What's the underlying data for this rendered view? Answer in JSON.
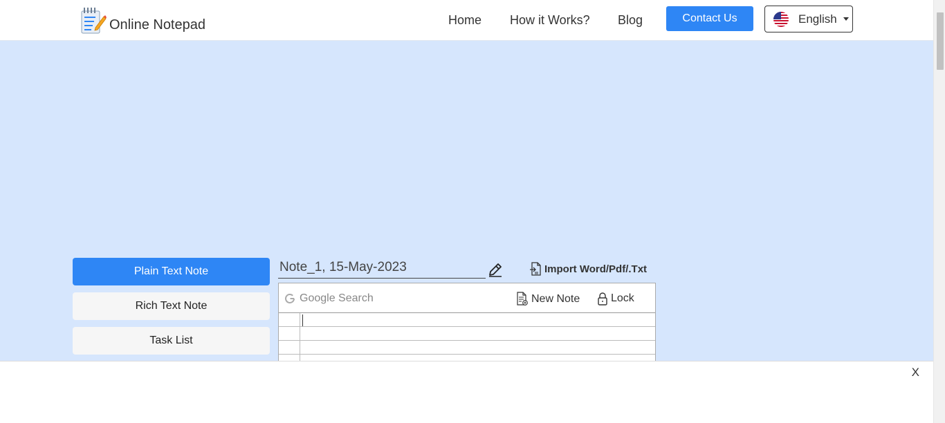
{
  "header": {
    "logo_text": "Online Notepad",
    "nav": [
      "Home",
      "How it Works?",
      "Blog"
    ],
    "contact_label": "Contact Us",
    "language": "English"
  },
  "sidebar": {
    "items": [
      {
        "label": "Plain Text Note",
        "active": true
      },
      {
        "label": "Rich Text Note",
        "active": false
      },
      {
        "label": "Task List",
        "active": false
      }
    ]
  },
  "note": {
    "title": "Note_1, 15-May-2023",
    "import_label": "Import Word/Pdf/.Txt"
  },
  "toolbar": {
    "search_placeholder": "Google Search",
    "new_note_label": "New Note",
    "lock_label": "Lock"
  },
  "bottom_bar": {
    "close_label": "X"
  },
  "colors": {
    "accent": "#2e86f5",
    "page_bg": "#d6e6fd"
  }
}
